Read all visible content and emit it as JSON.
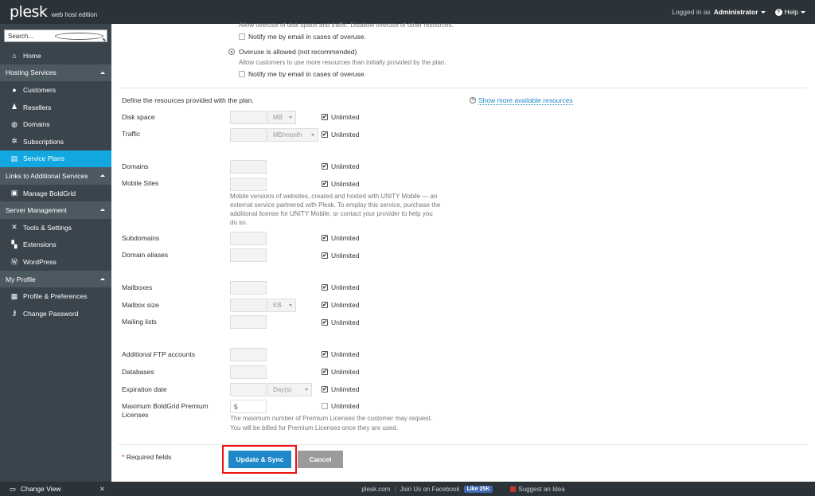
{
  "topbar": {
    "logo": "plesk",
    "edition": "web host edition",
    "logged_in_as": "Logged in as",
    "user": "Administrator",
    "help": "Help"
  },
  "sidebar": {
    "search_placeholder": "Search...",
    "home": "Home",
    "sections": [
      {
        "title": "Hosting Services",
        "items": [
          "Customers",
          "Resellers",
          "Domains",
          "Subscriptions",
          "Service Plans"
        ]
      },
      {
        "title": "Links to Additional Services",
        "items": [
          "Manage BoldGrid"
        ]
      },
      {
        "title": "Server Management",
        "items": [
          "Tools & Settings",
          "Extensions",
          "WordPress"
        ]
      },
      {
        "title": "My Profile",
        "items": [
          "Profile & Preferences",
          "Change Password"
        ]
      }
    ],
    "change_view": "Change View"
  },
  "overuse": {
    "top_hint": "Allow overuse of disk space and traffic. Disallow overuse of other resources.",
    "notify1": "Notify me by email in cases of overuse.",
    "option_allowed": "Overuse is allowed (not recommended)",
    "option_hint": "Allow customers to use more resources than initially provided by the plan.",
    "notify2": "Notify me by email in cases of overuse."
  },
  "resources": {
    "intro": "Define the resources provided with the plan.",
    "show_more": "Show more available resources",
    "unlimited": "Unlimited",
    "rows": {
      "disk_space": {
        "label": "Disk space",
        "unit": "MB"
      },
      "traffic": {
        "label": "Traffic",
        "unit": "MB/month"
      },
      "domains": {
        "label": "Domains"
      },
      "mobile_sites": {
        "label": "Mobile Sites",
        "hint_lines": [
          "Mobile versions of websites, created and hosted with UNITY Mobile — an",
          "external service partnered with Plesk. To employ this service, purchase the",
          "additional license for UNITY Mobile, or contact your provider to help you",
          "do so."
        ]
      },
      "subdomains": {
        "label": "Subdomains"
      },
      "domain_aliases": {
        "label": "Domain aliases"
      },
      "mailboxes": {
        "label": "Mailboxes"
      },
      "mailbox_size": {
        "label": "Mailbox size",
        "unit": "KB"
      },
      "mailing_lists": {
        "label": "Mailing lists"
      },
      "ftp": {
        "label": "Additional FTP accounts"
      },
      "databases": {
        "label": "Databases"
      },
      "expiration": {
        "label": "Expiration date",
        "unit": "Day(s)"
      },
      "boldgrid": {
        "label_line1": "Maximum BoldGrid Premium",
        "label_line2": "Licenses",
        "value": "5",
        "hint_lines": [
          "The maximum number of Premium Licenses the customer may request.",
          "You will be billed for Premium Licenses once they are used."
        ]
      }
    }
  },
  "actions": {
    "required": "Required fields",
    "update": "Update & Sync",
    "cancel": "Cancel"
  },
  "footer": {
    "site": "plesk.com",
    "join": "Join Us on Facebook",
    "like": "Like 25K",
    "suggest": "Suggest an Idea"
  }
}
